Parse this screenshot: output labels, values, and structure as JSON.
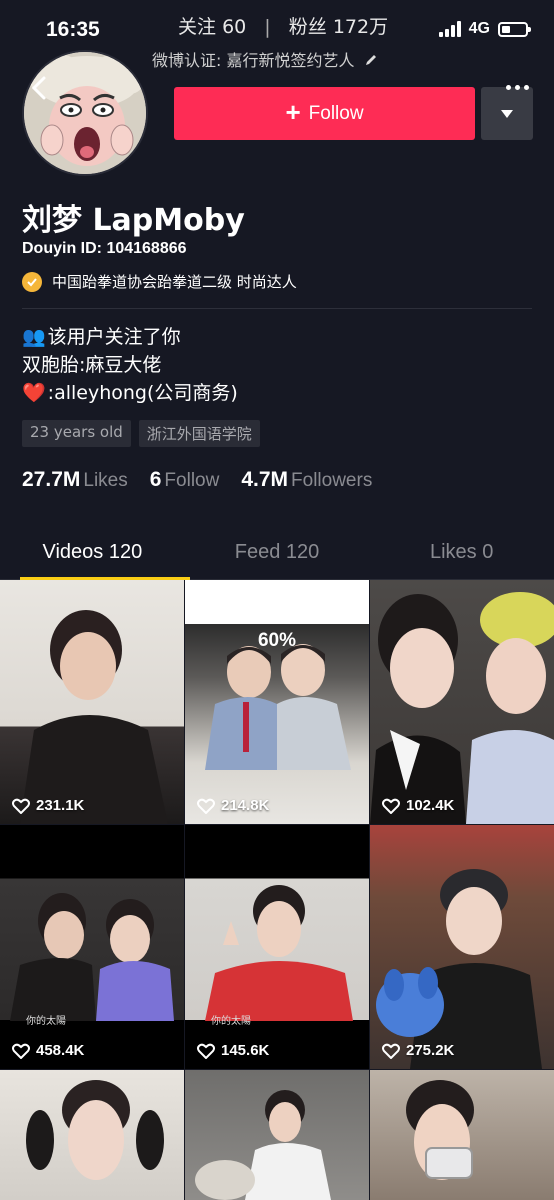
{
  "status_bar": {
    "time": "16:35",
    "network": "4G"
  },
  "header": {
    "following_label": "关注",
    "following_count": "60",
    "fans_label": "粉丝",
    "fans_count": "172万",
    "verification_text": "微博认证: 嘉行新悦签约艺人"
  },
  "profile": {
    "follow_label": "Follow",
    "name": "刘梦 LapMoby",
    "douyin_id": "Douyin ID: 104168866",
    "verified_text": "中国跆拳道协会跆拳道二级 时尚达人",
    "bio": [
      {
        "icon": "👥",
        "text": "该用户关注了你"
      },
      {
        "icon": "",
        "text": "双胞胎:麻豆大佬"
      },
      {
        "icon": "❤️",
        "text": ":alleyhong(公司商务)"
      }
    ],
    "tags": [
      "23 years old",
      "浙江外国语学院"
    ],
    "stats": {
      "likes_value": "27.7M",
      "likes_label": "Likes",
      "follow_value": "6",
      "follow_label": "Follow",
      "followers_value": "4.7M",
      "followers_label": "Followers"
    }
  },
  "tabs": [
    {
      "label": "Videos 120",
      "active": true
    },
    {
      "label": "Feed 120",
      "active": false
    },
    {
      "label": "Likes 0",
      "active": false
    }
  ],
  "videos": [
    {
      "likes": "231.1K",
      "overlay": "",
      "caption": ""
    },
    {
      "likes": "214.8K",
      "overlay": "60%",
      "caption": ""
    },
    {
      "likes": "102.4K",
      "overlay": "",
      "caption": ""
    },
    {
      "likes": "458.4K",
      "overlay": "",
      "caption": "你的太陽"
    },
    {
      "likes": "145.6K",
      "overlay": "",
      "caption": "你的太陽"
    },
    {
      "likes": "275.2K",
      "overlay": "",
      "caption": ""
    },
    {
      "likes": "",
      "overlay": "",
      "caption": ""
    },
    {
      "likes": "",
      "overlay": "",
      "caption": ""
    },
    {
      "likes": "",
      "overlay": "",
      "caption": ""
    }
  ],
  "colors": {
    "background": "#161823",
    "follow_button": "#fe2c55",
    "tab_indicator": "#face15",
    "verified_badge": "#f5b63a"
  }
}
